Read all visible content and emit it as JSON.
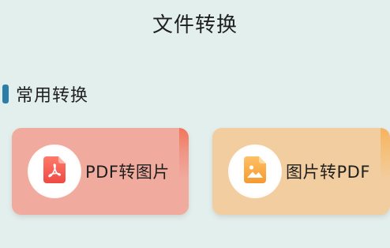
{
  "header": {
    "title": "文件转换"
  },
  "section": {
    "title": "常用转换",
    "accent_color": "#2b7fa6"
  },
  "cards": [
    {
      "label": "PDF转图片",
      "icon": "pdf-file-icon",
      "background_color": "#f1ab9e",
      "icon_color": "#f25a4e"
    },
    {
      "label": "图片转PDF",
      "icon": "image-file-icon",
      "background_color": "#f2cd9f",
      "icon_color": "#f5a33c"
    }
  ]
}
